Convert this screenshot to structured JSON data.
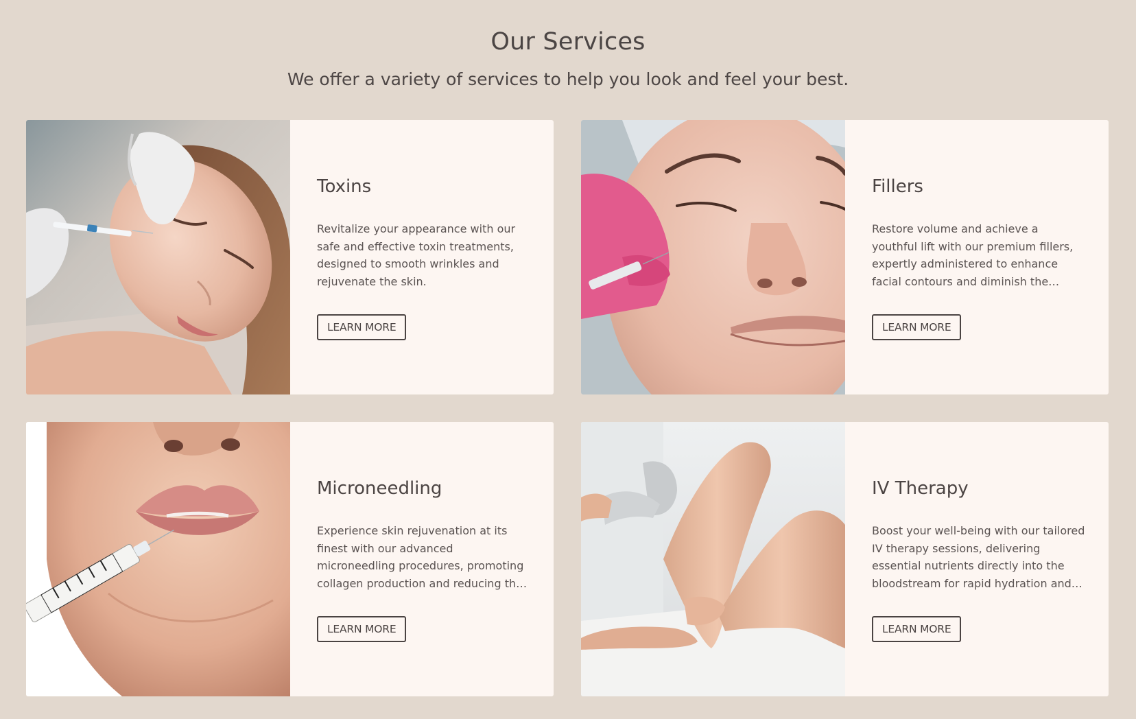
{
  "header": {
    "title": "Our Services",
    "subtitle": "We offer a variety of services to help you look and feel your best."
  },
  "services": [
    {
      "title": "Toxins",
      "description": "Revitalize your appearance with our safe and effective toxin treatments, designed to smooth wrinkles and rejuvenate the skin.",
      "button_label": "LEARN MORE",
      "image": "woman-receiving-toxin-injection-photo"
    },
    {
      "title": "Fillers",
      "description": "Restore volume and achieve a youthful lift with our premium fillers, expertly administered to enhance facial contours and diminish the appearance of fine lines.",
      "button_label": "LEARN MORE",
      "image": "woman-receiving-cheek-filler-photo"
    },
    {
      "title": "Microneedling",
      "description": "Experience skin rejuvenation at its finest with our advanced microneedling procedures, promoting collagen production and reducing the appearance of scars.",
      "button_label": "LEARN MORE",
      "image": "lip-injection-syringe-photo"
    },
    {
      "title": "IV Therapy",
      "description": "Boost your well-being with our tailored IV therapy sessions, delivering essential nutrients directly into the bloodstream for rapid hydration and recovery.",
      "button_label": "LEARN MORE",
      "image": "laser-leg-treatment-photo"
    }
  ],
  "colors": {
    "page_background": "#e2d8ce",
    "card_background": "#fdf6f2",
    "text": "#4a4342",
    "button_border": "#4a4342"
  }
}
